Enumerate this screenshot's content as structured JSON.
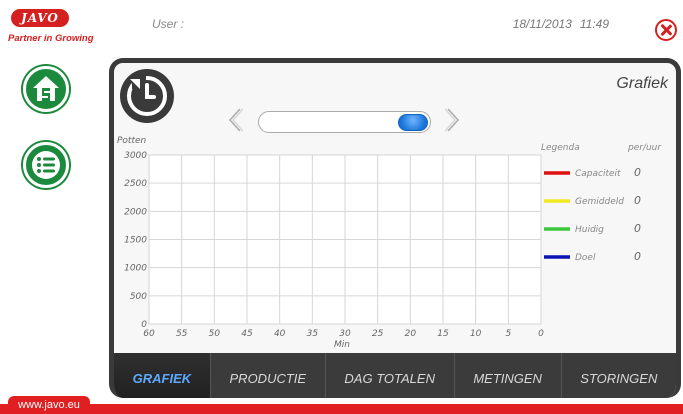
{
  "header": {
    "logo_text": "JAVO",
    "tagline": "Partner in Growing",
    "user_label": "User :",
    "date": "18/11/2013",
    "time": "11:49"
  },
  "nav": [
    {
      "icon": "home-icon"
    },
    {
      "icon": "list-icon"
    }
  ],
  "panel": {
    "title": "Grafiek",
    "reset_icon": "history-reset-icon"
  },
  "colors": {
    "brand_red": "#d42020",
    "nav_green": "#1c8a3d",
    "active_tab": "#5da9ff",
    "slider_blue": "#1a74d8"
  },
  "chart_data": {
    "type": "line",
    "ylabel": "Potten",
    "xlabel": "Min",
    "y_ticks": [
      "3000",
      "2500",
      "2000",
      "1500",
      "1000",
      "500",
      "0"
    ],
    "x_ticks": [
      "60",
      "55",
      "50",
      "45",
      "40",
      "35",
      "30",
      "25",
      "20",
      "15",
      "10",
      "5",
      "0"
    ],
    "ylim": [
      0,
      3000
    ],
    "xlim": [
      60,
      0
    ],
    "grid": true,
    "legend_position": "right",
    "legend_title": "Legenda",
    "legend_unit": "per/uur",
    "series": [
      {
        "name": "Capaciteit",
        "color": "#e01010",
        "value": "0"
      },
      {
        "name": "Gemiddeld",
        "color": "#f0e820",
        "value": "0"
      },
      {
        "name": "Huidig",
        "color": "#3cc83c",
        "value": "0"
      },
      {
        "name": "Doel",
        "color": "#0a14b4",
        "value": "0"
      }
    ]
  },
  "tabs": [
    {
      "label": "GRAFIEK",
      "active": true
    },
    {
      "label": "PRODUCTIE",
      "active": false
    },
    {
      "label": "DAG TOTALEN",
      "active": false
    },
    {
      "label": "METINGEN",
      "active": false
    },
    {
      "label": "STORINGEN",
      "active": false
    }
  ],
  "footer": {
    "link": "www.javo.eu"
  }
}
